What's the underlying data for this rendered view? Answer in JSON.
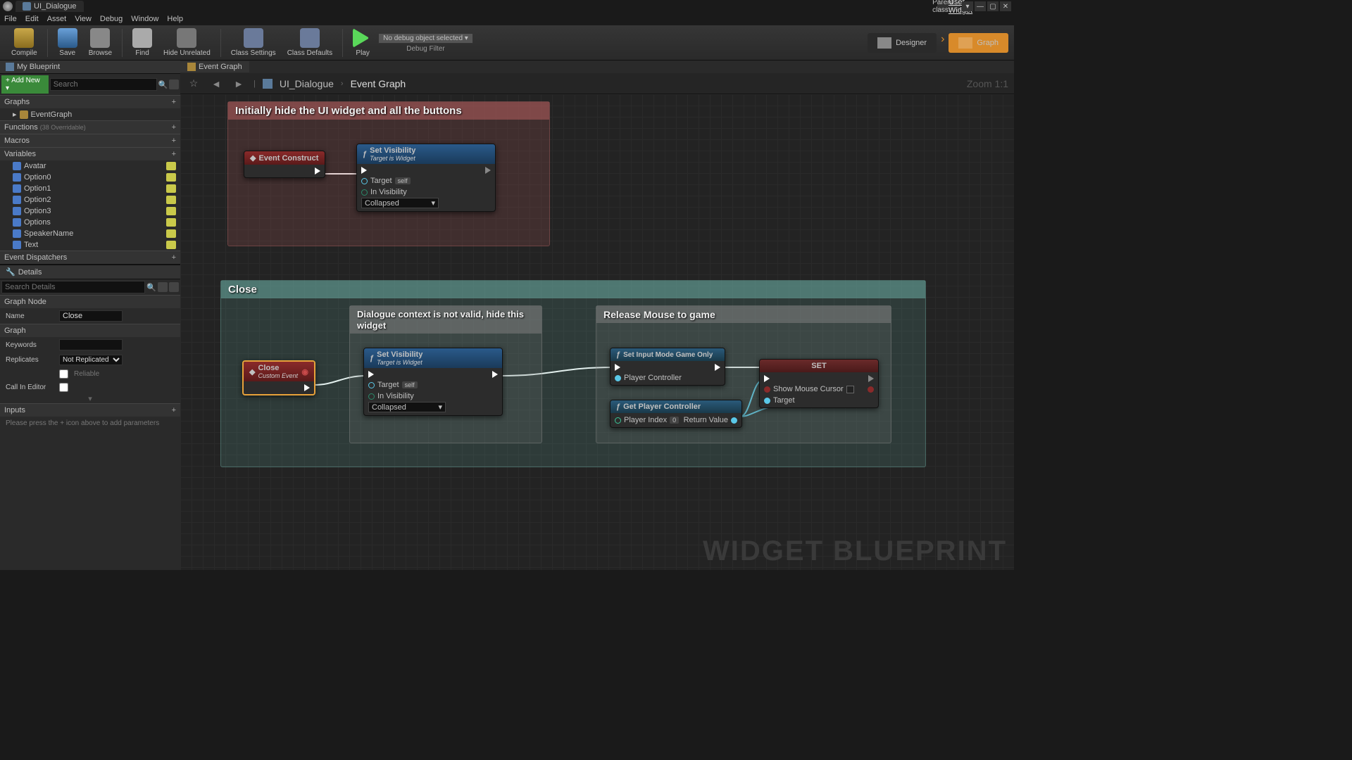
{
  "titlebar": {
    "tab": "UI_Dialogue",
    "parent_label": "Parent class:",
    "parent_class": "User Widget"
  },
  "menubar": [
    "File",
    "Edit",
    "Asset",
    "View",
    "Debug",
    "Window",
    "Help"
  ],
  "toolbar": {
    "compile": "Compile",
    "save": "Save",
    "browse": "Browse",
    "find": "Find",
    "hide": "Hide Unrelated",
    "settings": "Class Settings",
    "defaults": "Class Defaults",
    "play": "Play",
    "debug_object": "No debug object selected ▾",
    "debug_filter": "Debug Filter",
    "designer": "Designer",
    "graph": "Graph"
  },
  "left": {
    "my_blueprint": "My Blueprint",
    "add_new": "+ Add New ▾",
    "search_ph": "Search",
    "graphs": "Graphs",
    "eventgraph": "EventGraph",
    "functions": "Functions",
    "functions_note": "(38 Overridable)",
    "macros": "Macros",
    "variables": "Variables",
    "vars": [
      {
        "name": "Avatar",
        "color": "blue"
      },
      {
        "name": "Option0",
        "color": "blue"
      },
      {
        "name": "Option1",
        "color": "blue"
      },
      {
        "name": "Option2",
        "color": "blue"
      },
      {
        "name": "Option3",
        "color": "blue"
      },
      {
        "name": "Options",
        "color": "blue"
      },
      {
        "name": "SpeakerName",
        "color": "blue"
      },
      {
        "name": "Text",
        "color": "blue"
      }
    ],
    "dispatchers": "Event Dispatchers"
  },
  "details": {
    "title": "Details",
    "search_ph": "Search Details",
    "graph_node": "Graph Node",
    "name_lbl": "Name",
    "name_val": "Close",
    "graph": "Graph",
    "keywords_lbl": "Keywords",
    "keywords_val": "",
    "replicates_lbl": "Replicates",
    "replicates_val": "Not Replicated",
    "reliable": "Reliable",
    "call_editor": "Call In Editor",
    "inputs": "Inputs",
    "inputs_note": "Please press the + icon above to add parameters"
  },
  "center": {
    "tab": "Event Graph",
    "bc_root": "UI_Dialogue",
    "bc_leaf": "Event Graph",
    "zoom": "Zoom 1:1",
    "watermark": "WIDGET BLUEPRINT"
  },
  "comments": {
    "c1": "Initially hide the UI widget and all the buttons",
    "c2": "Close",
    "c3": "Dialogue context is not valid, hide this widget",
    "c4": "Release Mouse to game"
  },
  "nodes": {
    "event_construct": "Event Construct",
    "set_vis": "Set Visibility",
    "set_vis_sub": "Target is Widget",
    "target": "Target",
    "self": "self",
    "in_vis": "In Visibility",
    "collapsed": "Collapsed",
    "close": "Close",
    "custom_event": "Custom Event",
    "set_input": "Set Input Mode Game Only",
    "player_controller": "Player Controller",
    "get_pc": "Get Player Controller",
    "player_index": "Player Index",
    "pi_val": "0",
    "return_value": "Return Value",
    "set": "SET",
    "show_cursor": "Show Mouse Cursor"
  }
}
